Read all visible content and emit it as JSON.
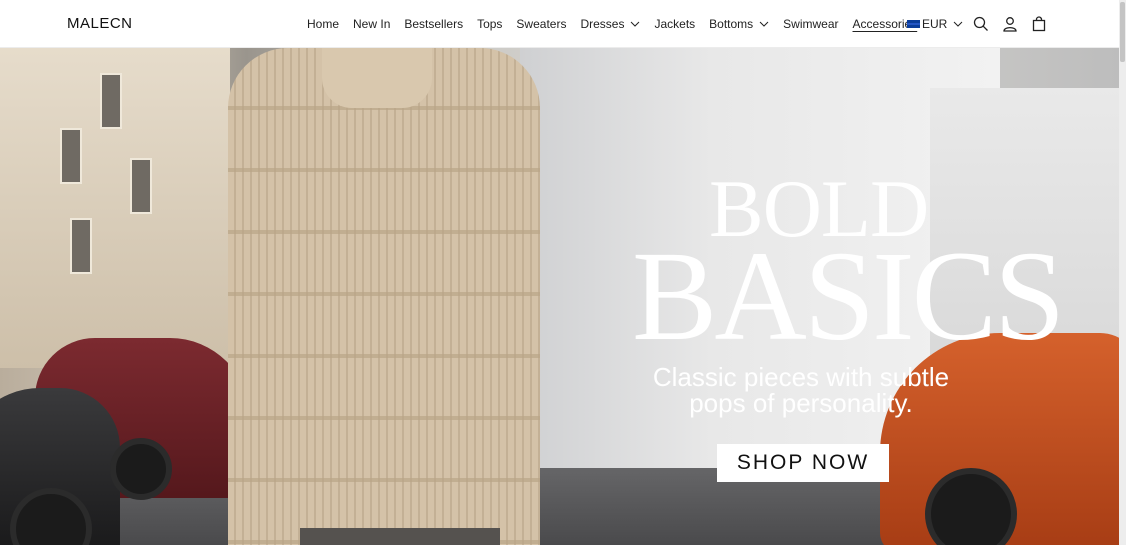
{
  "brand": {
    "logo": "MALECN"
  },
  "nav": {
    "items": [
      {
        "label": "Home",
        "dropdown": false
      },
      {
        "label": "New In",
        "dropdown": false
      },
      {
        "label": "Bestsellers",
        "dropdown": false
      },
      {
        "label": "Tops",
        "dropdown": false
      },
      {
        "label": "Sweaters",
        "dropdown": false
      },
      {
        "label": "Dresses",
        "dropdown": true
      },
      {
        "label": "Jackets",
        "dropdown": false
      },
      {
        "label": "Bottoms",
        "dropdown": true
      },
      {
        "label": "Swimwear",
        "dropdown": false
      },
      {
        "label": "Accessories",
        "dropdown": false,
        "active": true
      }
    ]
  },
  "currency": {
    "code": "EUR",
    "flag": "eu-flag-icon"
  },
  "header_icons": [
    "search-icon",
    "user-icon",
    "bag-icon"
  ],
  "hero": {
    "headline_line1": "BOLD",
    "headline_line2": "BASICS",
    "subtitle": "Classic pieces with subtle pops of personality.",
    "cta_label": "SHOP NOW"
  },
  "colors": {
    "text": "#222222",
    "hero_text": "#ffffff",
    "cta_bg": "#ffffff"
  }
}
